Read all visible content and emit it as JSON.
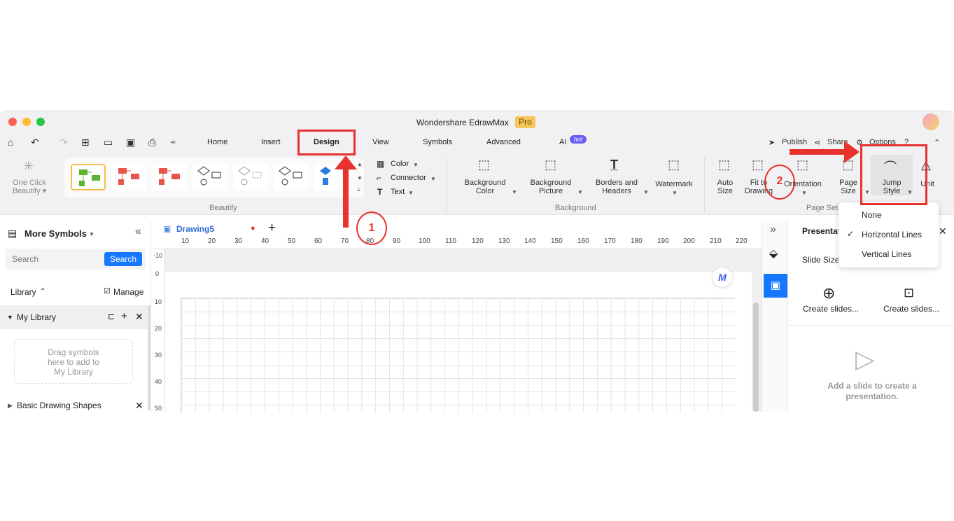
{
  "window": {
    "title": "Wondershare EdrawMax",
    "badge": "Pro"
  },
  "menu": {
    "tabs": [
      "Home",
      "Insert",
      "Design",
      "View",
      "Symbols",
      "Advanced",
      "AI"
    ],
    "ai_badge": "hot",
    "right": {
      "publish": "Publish",
      "share": "Share",
      "options": "Options"
    }
  },
  "ribbon": {
    "beautify": {
      "one_click_line1": "One Click",
      "one_click_line2": "Beautify",
      "group": "Beautify"
    },
    "style_options": {
      "color": "Color",
      "connector": "Connector",
      "text": "Text"
    },
    "background": {
      "bg_color_1": "Background",
      "bg_color_2": "Color",
      "bg_picture_1": "Background",
      "bg_picture_2": "Picture",
      "borders_1": "Borders and",
      "borders_2": "Headers",
      "watermark": "Watermark",
      "group": "Background"
    },
    "page_setup": {
      "auto_1": "Auto",
      "auto_2": "Size",
      "fit_1": "Fit to",
      "fit_2": "Drawing",
      "orientation": "Orientation",
      "page_1": "Page",
      "page_2": "Size",
      "jump_1": "Jump",
      "jump_2": "Style",
      "unit": "Unit",
      "group": "Page Setup"
    }
  },
  "jump_menu": {
    "items": [
      "None",
      "Horizontal Lines",
      "Vertical Lines"
    ],
    "selected": "Horizontal Lines"
  },
  "left_panel": {
    "title": "More Symbols",
    "search_placeholder": "Search",
    "search_button": "Search",
    "library": "Library",
    "manage": "Manage",
    "my_library": "My Library",
    "drag_hint_1": "Drag symbols",
    "drag_hint_2": "here to add to",
    "drag_hint_3": "My Library",
    "basic_shapes": "Basic Drawing Shapes"
  },
  "document": {
    "tab": "Drawing5",
    "ruler_h": [
      "10",
      "20",
      "30",
      "40",
      "50",
      "60",
      "70",
      "80",
      "90",
      "100",
      "110",
      "120",
      "130",
      "140",
      "150",
      "160",
      "170",
      "180",
      "190",
      "200",
      "210",
      "220"
    ],
    "ruler_v": [
      "-10",
      "0",
      "10",
      "20",
      "30",
      "40",
      "50"
    ]
  },
  "right_panel": {
    "title": "Presentation",
    "slide_size": "Slide Size",
    "create1": "Create slides...",
    "create2": "Create slides...",
    "empty_1": "Add a slide to create a",
    "empty_2": "presentation."
  },
  "annotations": {
    "step1": "1",
    "step2": "2"
  },
  "colors": {
    "accent": "#1677ff",
    "annotation_red": "#e8322e",
    "pro_badge": "#f7c75a"
  }
}
